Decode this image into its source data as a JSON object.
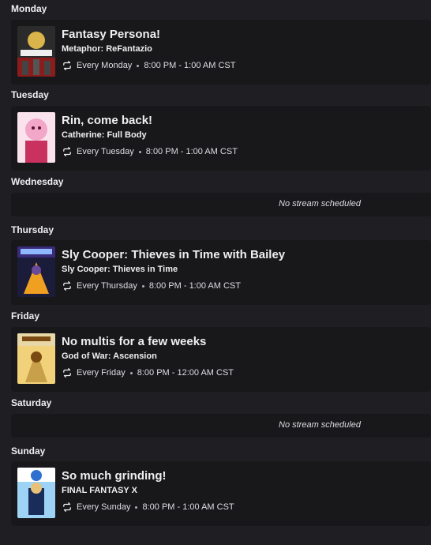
{
  "days": [
    {
      "day": "Monday",
      "stream": {
        "title": "Fantasy Persona!",
        "game": "Metaphor: ReFantazio",
        "recurrence": "Every Monday",
        "time": "8:00 PM - 1:00 AM CST",
        "cover_colors": [
          "#8a1c1c",
          "#d9b44a",
          "#2b2b2b"
        ]
      }
    },
    {
      "day": "Tuesday",
      "stream": {
        "title": "Rin, come back!",
        "game": "Catherine: Full Body",
        "recurrence": "Every Tuesday",
        "time": "8:00 PM - 1:00 AM CST",
        "cover_colors": [
          "#f2a6c8",
          "#c9325f",
          "#fbe3ee"
        ]
      }
    },
    {
      "day": "Wednesday",
      "empty_text": "No stream scheduled"
    },
    {
      "day": "Thursday",
      "stream": {
        "title": "Sly Cooper: Thieves in Time with Bailey",
        "game": "Sly Cooper: Thieves in Time",
        "recurrence": "Every Thursday",
        "time": "8:00 PM - 1:00 AM CST",
        "cover_colors": [
          "#3a2a7a",
          "#f0a020",
          "#1b1b3a"
        ]
      }
    },
    {
      "day": "Friday",
      "stream": {
        "title": "No multis for a few weeks",
        "game": "God of War: Ascension",
        "recurrence": "Every Friday",
        "time": "8:00 PM - 12:00 AM CST",
        "cover_colors": [
          "#c8a04a",
          "#7a4a12",
          "#f1d27a"
        ]
      }
    },
    {
      "day": "Saturday",
      "empty_text": "No stream scheduled"
    },
    {
      "day": "Sunday",
      "stream": {
        "title": "So much grinding!",
        "game": "FINAL FANTASY X",
        "recurrence": "Every Sunday",
        "time": "8:00 PM - 1:00 AM CST",
        "cover_colors": [
          "#2e6fd0",
          "#9fd3f5",
          "#1a2d5a"
        ]
      }
    }
  ]
}
